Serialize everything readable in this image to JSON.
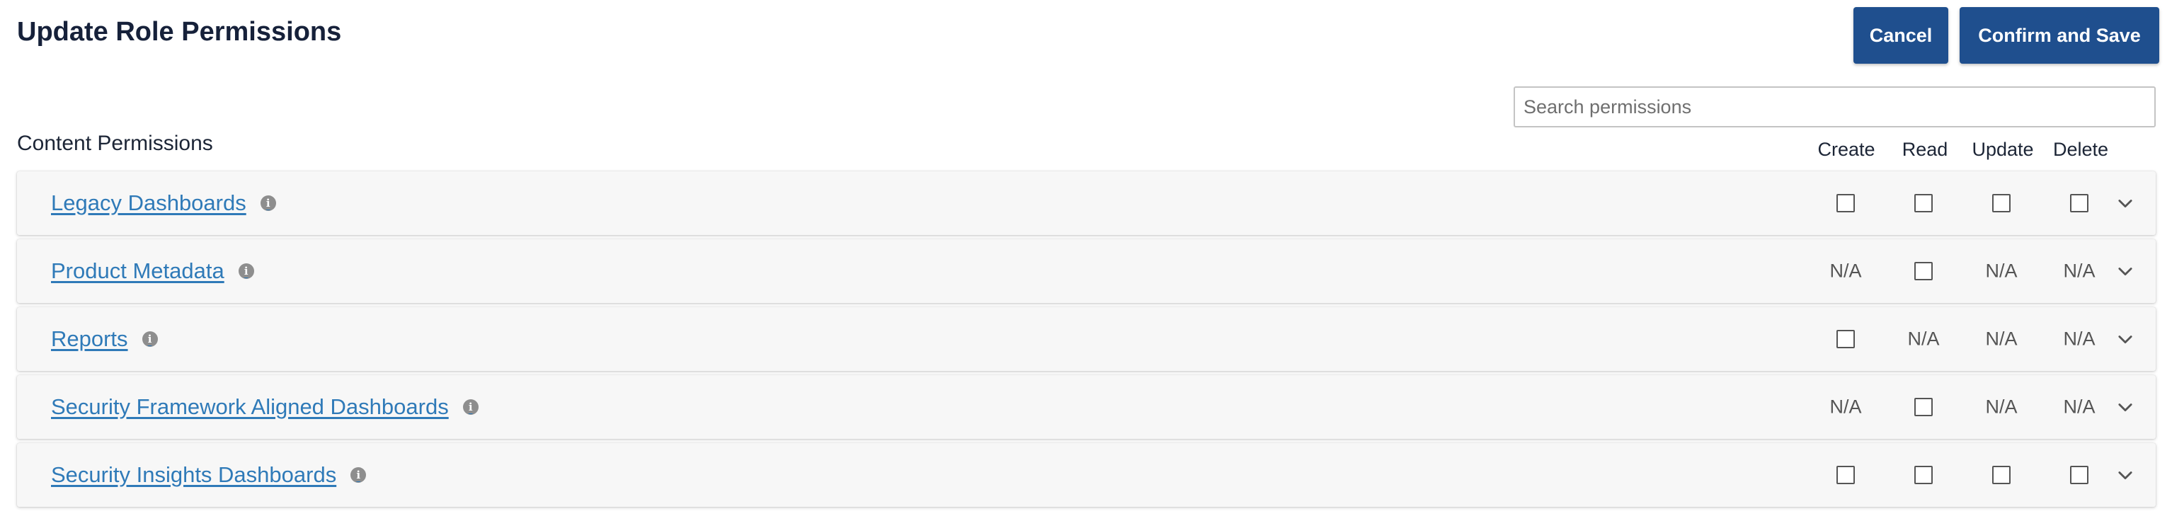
{
  "header": {
    "title": "Update Role Permissions",
    "cancel_label": "Cancel",
    "save_label": "Confirm and Save"
  },
  "search": {
    "placeholder": "Search permissions",
    "value": ""
  },
  "section": {
    "title": "Content Permissions"
  },
  "columns": [
    "Create",
    "Read",
    "Update",
    "Delete"
  ],
  "na_label": "N/A",
  "rows": [
    {
      "label": "Legacy Dashboards",
      "cells": [
        "checkbox",
        "checkbox",
        "checkbox",
        "checkbox"
      ]
    },
    {
      "label": "Product Metadata",
      "cells": [
        "na",
        "checkbox",
        "na",
        "na"
      ]
    },
    {
      "label": "Reports",
      "cells": [
        "checkbox",
        "na",
        "na",
        "na"
      ]
    },
    {
      "label": "Security Framework Aligned Dashboards",
      "cells": [
        "na",
        "checkbox",
        "na",
        "na"
      ]
    },
    {
      "label": "Security Insights Dashboards",
      "cells": [
        "checkbox",
        "checkbox",
        "checkbox",
        "checkbox"
      ]
    }
  ],
  "icons": {
    "info": "info-icon",
    "expand": "chevron-down-icon"
  },
  "colors": {
    "primary_button": "#1f4f8e",
    "link": "#2f7ab8",
    "row_background": "#f7f7f7"
  }
}
